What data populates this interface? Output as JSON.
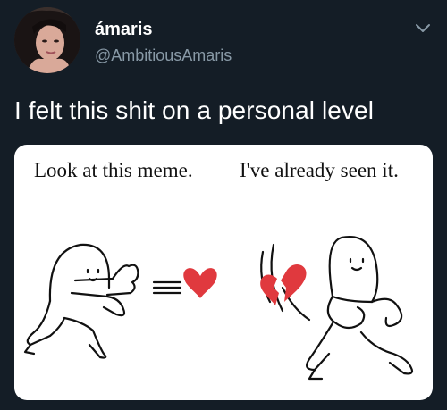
{
  "user": {
    "display_name": "ámaris",
    "handle": "@AmbitiousAmaris",
    "avatar_icon": "profile-photo"
  },
  "tweet": {
    "text": "I felt this shit on a personal level",
    "menu_icon": "chevron-down-icon"
  },
  "meme": {
    "left_caption": "Look at this meme.",
    "right_caption": "I've already seen it.",
    "heart_color": "#e0393e"
  },
  "colors": {
    "background": "#141d26",
    "secondary_text": "#8899a6"
  }
}
